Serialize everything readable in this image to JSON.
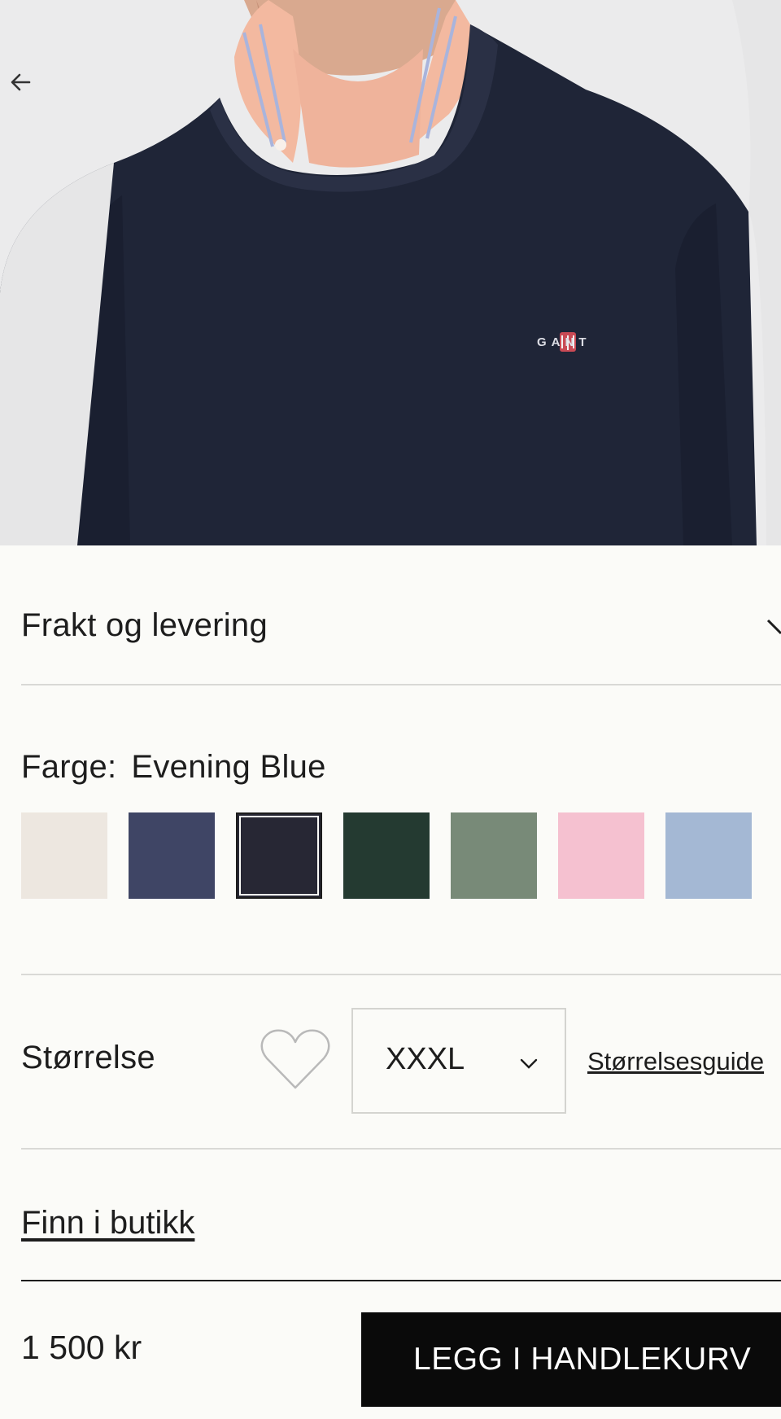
{
  "product_image": {
    "logo_text": "GANT"
  },
  "nav": {
    "back_icon": "arrow-left-icon"
  },
  "shipping": {
    "label": "Frakt og levering",
    "icon": "chevron-down-icon"
  },
  "color": {
    "label": "Farge:",
    "selected_name": "Evening Blue",
    "swatches": [
      {
        "hex": "#ede7e0",
        "selected": false
      },
      {
        "hex": "#3f4565",
        "selected": false
      },
      {
        "hex": "#272734",
        "selected": true
      },
      {
        "hex": "#243a31",
        "selected": false
      },
      {
        "hex": "#788a78",
        "selected": false
      },
      {
        "hex": "#f5c1d0",
        "selected": false
      },
      {
        "hex": "#a4b8d4",
        "selected": false
      }
    ]
  },
  "size": {
    "label": "Størrelse",
    "wishlist_icon": "heart-icon",
    "selected": "XXXL",
    "guide_label": "Størrelsesguide"
  },
  "store": {
    "label": "Finn i butikk"
  },
  "purchase": {
    "price": "1 500 kr",
    "add_to_cart_label": "LEGG I HANDLEKURV"
  }
}
